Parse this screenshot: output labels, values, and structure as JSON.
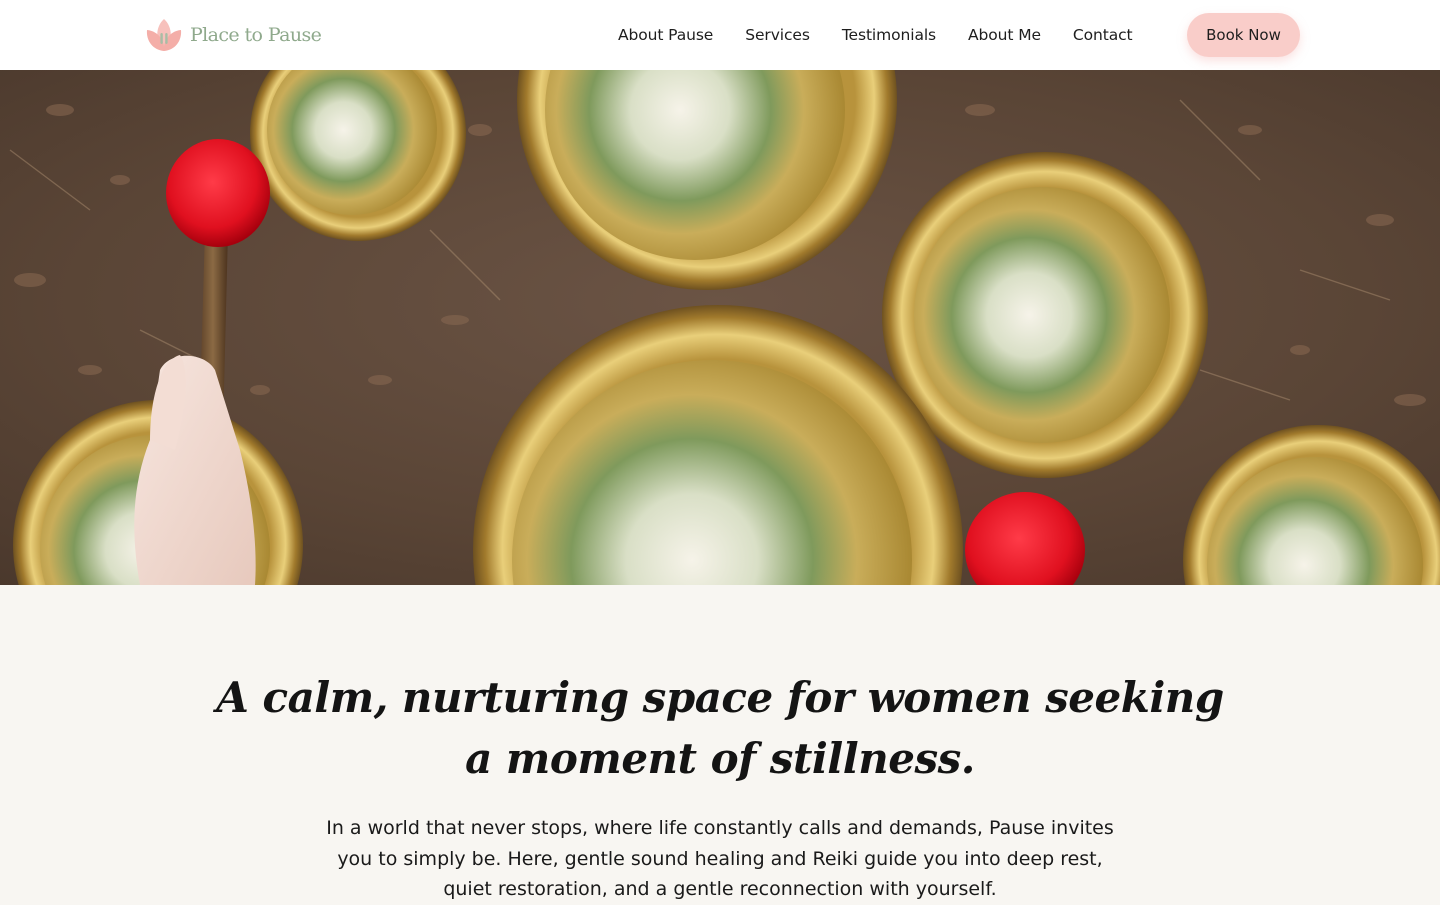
{
  "header": {
    "logo_text": "Place to Pause",
    "nav": [
      {
        "label": "About Pause"
      },
      {
        "label": "Services"
      },
      {
        "label": "Testimonials"
      },
      {
        "label": "About Me"
      },
      {
        "label": "Contact"
      }
    ],
    "book_button": "Book Now"
  },
  "hero": {
    "icon": "singing-bowls-photo"
  },
  "intro": {
    "headline": "A calm, nurturing space for women seeking a moment of stillness.",
    "body": "In a world that never stops, where life constantly calls and demands, Pause invites you to simply be. Here, gentle sound healing and Reiki guide you into deep rest, quiet restoration, and a gentle reconnection with yourself."
  },
  "colors": {
    "accent_pink": "#f9cdc9",
    "logo_green": "#8fa98c",
    "section_bg": "#f8f6f2"
  }
}
